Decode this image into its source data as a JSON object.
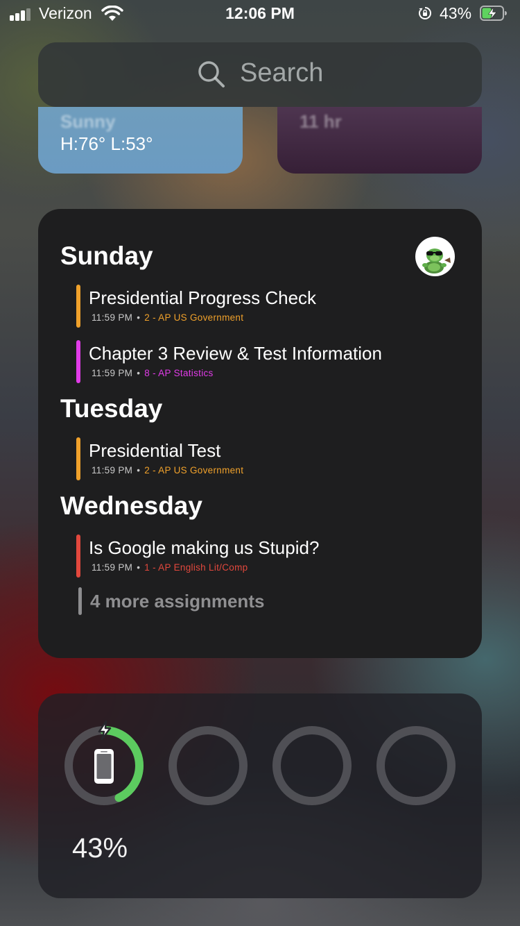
{
  "status_bar": {
    "carrier": "Verizon",
    "time": "12:06 PM",
    "battery_percent": "43%",
    "charging": true,
    "signal_bars_active": 3,
    "signal_bars_total": 4
  },
  "search": {
    "placeholder": "Search",
    "icon": "search-icon"
  },
  "weather_widget": {
    "condition": "Sunny",
    "hi_lo": "H:76° L:53°"
  },
  "sleep_widget": {
    "text": "11 hr"
  },
  "planner": {
    "days": [
      {
        "name": "Sunday",
        "assignments": [
          {
            "title": "Presidential Progress Check",
            "time": "11:59 PM",
            "course": "2 - AP US Government",
            "color": "#f0a12b"
          },
          {
            "title": "Chapter 3 Review & Test Information",
            "time": "11:59 PM",
            "course": "8 - AP Statistics",
            "color": "#e13ce8"
          }
        ]
      },
      {
        "name": "Tuesday",
        "assignments": [
          {
            "title": "Presidential Test",
            "time": "11:59 PM",
            "course": "2 - AP US Government",
            "color": "#f0a12b"
          }
        ]
      },
      {
        "name": "Wednesday",
        "assignments": [
          {
            "title": "Is Google making us Stupid?",
            "time": "11:59 PM",
            "course": "1 - AP English Lit/Comp",
            "color": "#e2483d"
          }
        ]
      }
    ],
    "more_label": "4 more assignments",
    "separator": "•"
  },
  "batteries_widget": {
    "device_icon": "iphone-icon",
    "charge_icon": "bolt-icon",
    "level": 0.43,
    "percent_label": "43%",
    "ring_color": "#5ccb5f",
    "empty_slots": 3
  }
}
